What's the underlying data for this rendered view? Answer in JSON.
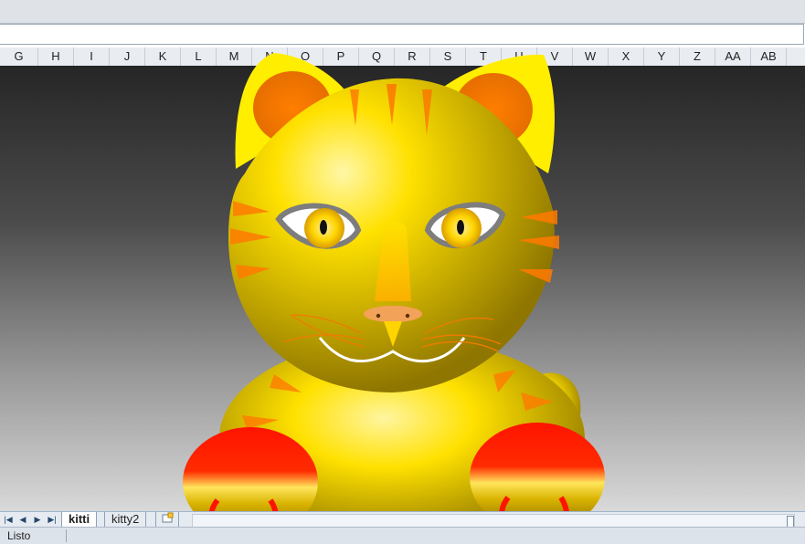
{
  "columns": [
    "G",
    "H",
    "I",
    "J",
    "K",
    "L",
    "M",
    "N",
    "O",
    "P",
    "Q",
    "R",
    "S",
    "T",
    "U",
    "V",
    "W",
    "X",
    "Y",
    "Z",
    "AA",
    "AB"
  ],
  "sheet_tabs": [
    {
      "label": "kitti",
      "active": true
    },
    {
      "label": "kitty2",
      "active": false
    }
  ],
  "navigation": {
    "first": "|◀",
    "prev": "◀",
    "next": "▶",
    "last": "▶|"
  },
  "status": {
    "text": "Listo"
  },
  "colors": {
    "fur": "#ffd400",
    "ear_inner": "#f07400",
    "stripes": "#ff7a00",
    "paws_top": "#ff0000",
    "nose": "#f3a25a",
    "whisker": "#ffffff"
  }
}
